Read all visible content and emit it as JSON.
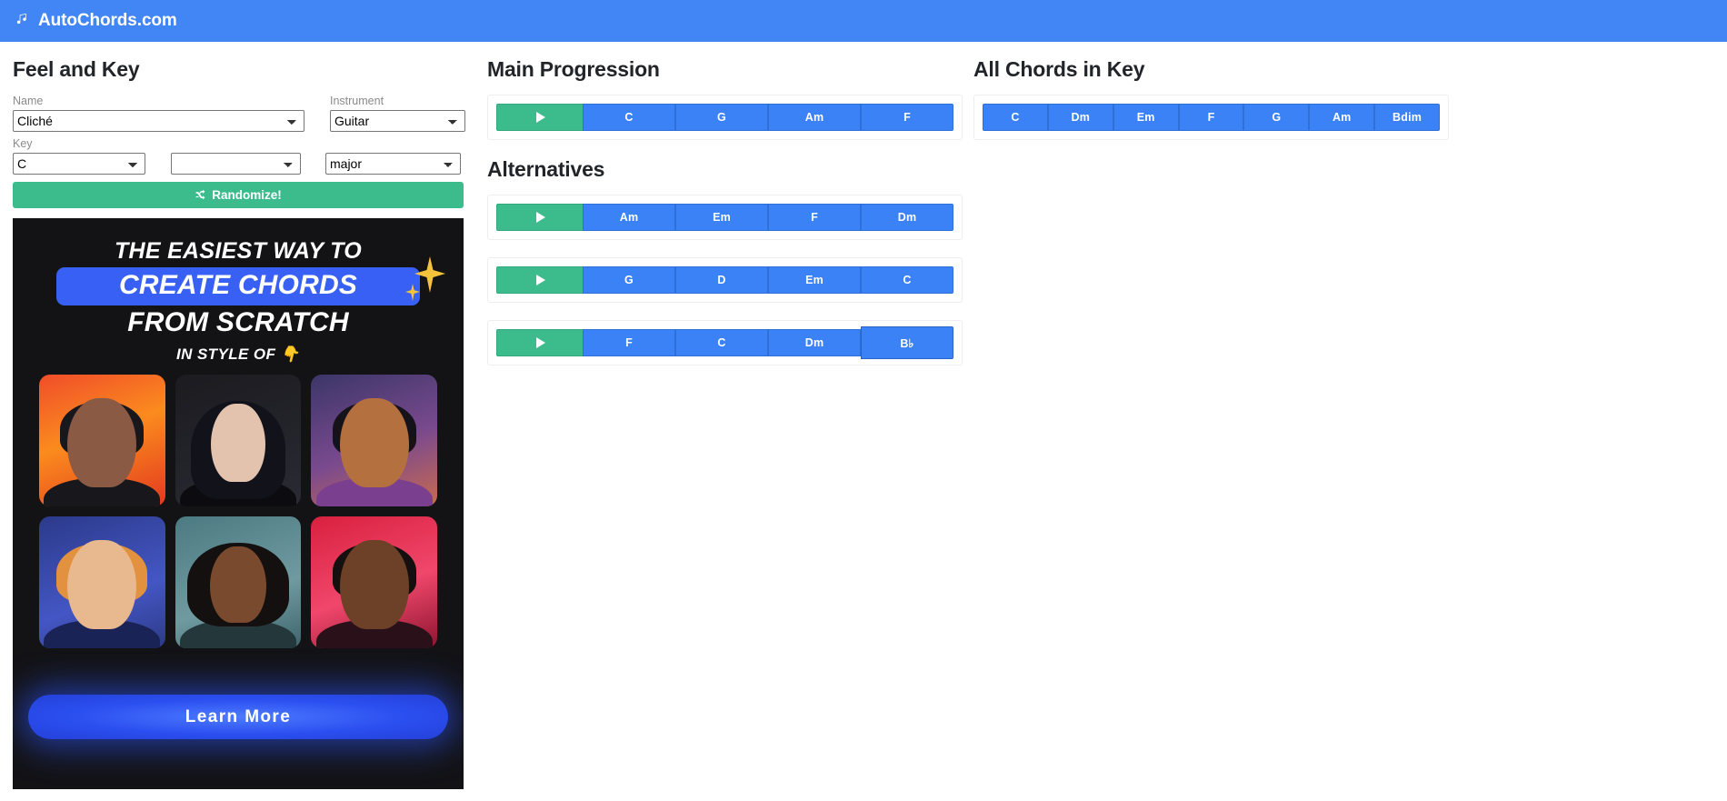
{
  "header": {
    "brand": "AutoChords.com",
    "logo_icon": "music-note-icon",
    "bg_color": "#4285f4"
  },
  "feel_and_key": {
    "title": "Feel and Key",
    "name_label": "Name",
    "name_value": "Cliché",
    "instrument_label": "Instrument",
    "instrument_value": "Guitar",
    "key_label": "Key",
    "key_value": "C",
    "accidental_value": "",
    "mode_value": "major",
    "randomize_label": "Randomize!",
    "randomize_icon": "shuffle-icon",
    "randomize_color": "#3cbc8d"
  },
  "ad": {
    "line1": "THE EASIEST WAY TO",
    "line2": "CREATE CHORDS",
    "line3": "FROM SCRATCH",
    "line4": "IN STYLE OF",
    "line4_emoji": "👇",
    "sparkle": "✦",
    "cta_label": "Learn More",
    "bg_color": "#131316",
    "highlight_color": "#3860f4"
  },
  "main_progression": {
    "title": "Main Progression",
    "play_label": "▶",
    "chords": [
      "C",
      "G",
      "Am",
      "F"
    ]
  },
  "alternatives": {
    "title": "Alternatives",
    "rows": [
      {
        "play_label": "▶",
        "chords": [
          "Am",
          "Em",
          "F",
          "Dm"
        ],
        "hovered_index": -1
      },
      {
        "play_label": "▶",
        "chords": [
          "G",
          "D",
          "Em",
          "C"
        ],
        "hovered_index": -1
      },
      {
        "play_label": "▶",
        "chords": [
          "F",
          "C",
          "Dm",
          "B♭"
        ],
        "hovered_index": 3
      }
    ]
  },
  "all_chords": {
    "title": "All Chords in Key",
    "chords": [
      "C",
      "Dm",
      "Em",
      "F",
      "G",
      "Am",
      "Bdim"
    ]
  },
  "colors": {
    "chord_blue": "#3b82f6",
    "play_green": "#3cbc8d",
    "brand_blue": "#4285f4"
  }
}
